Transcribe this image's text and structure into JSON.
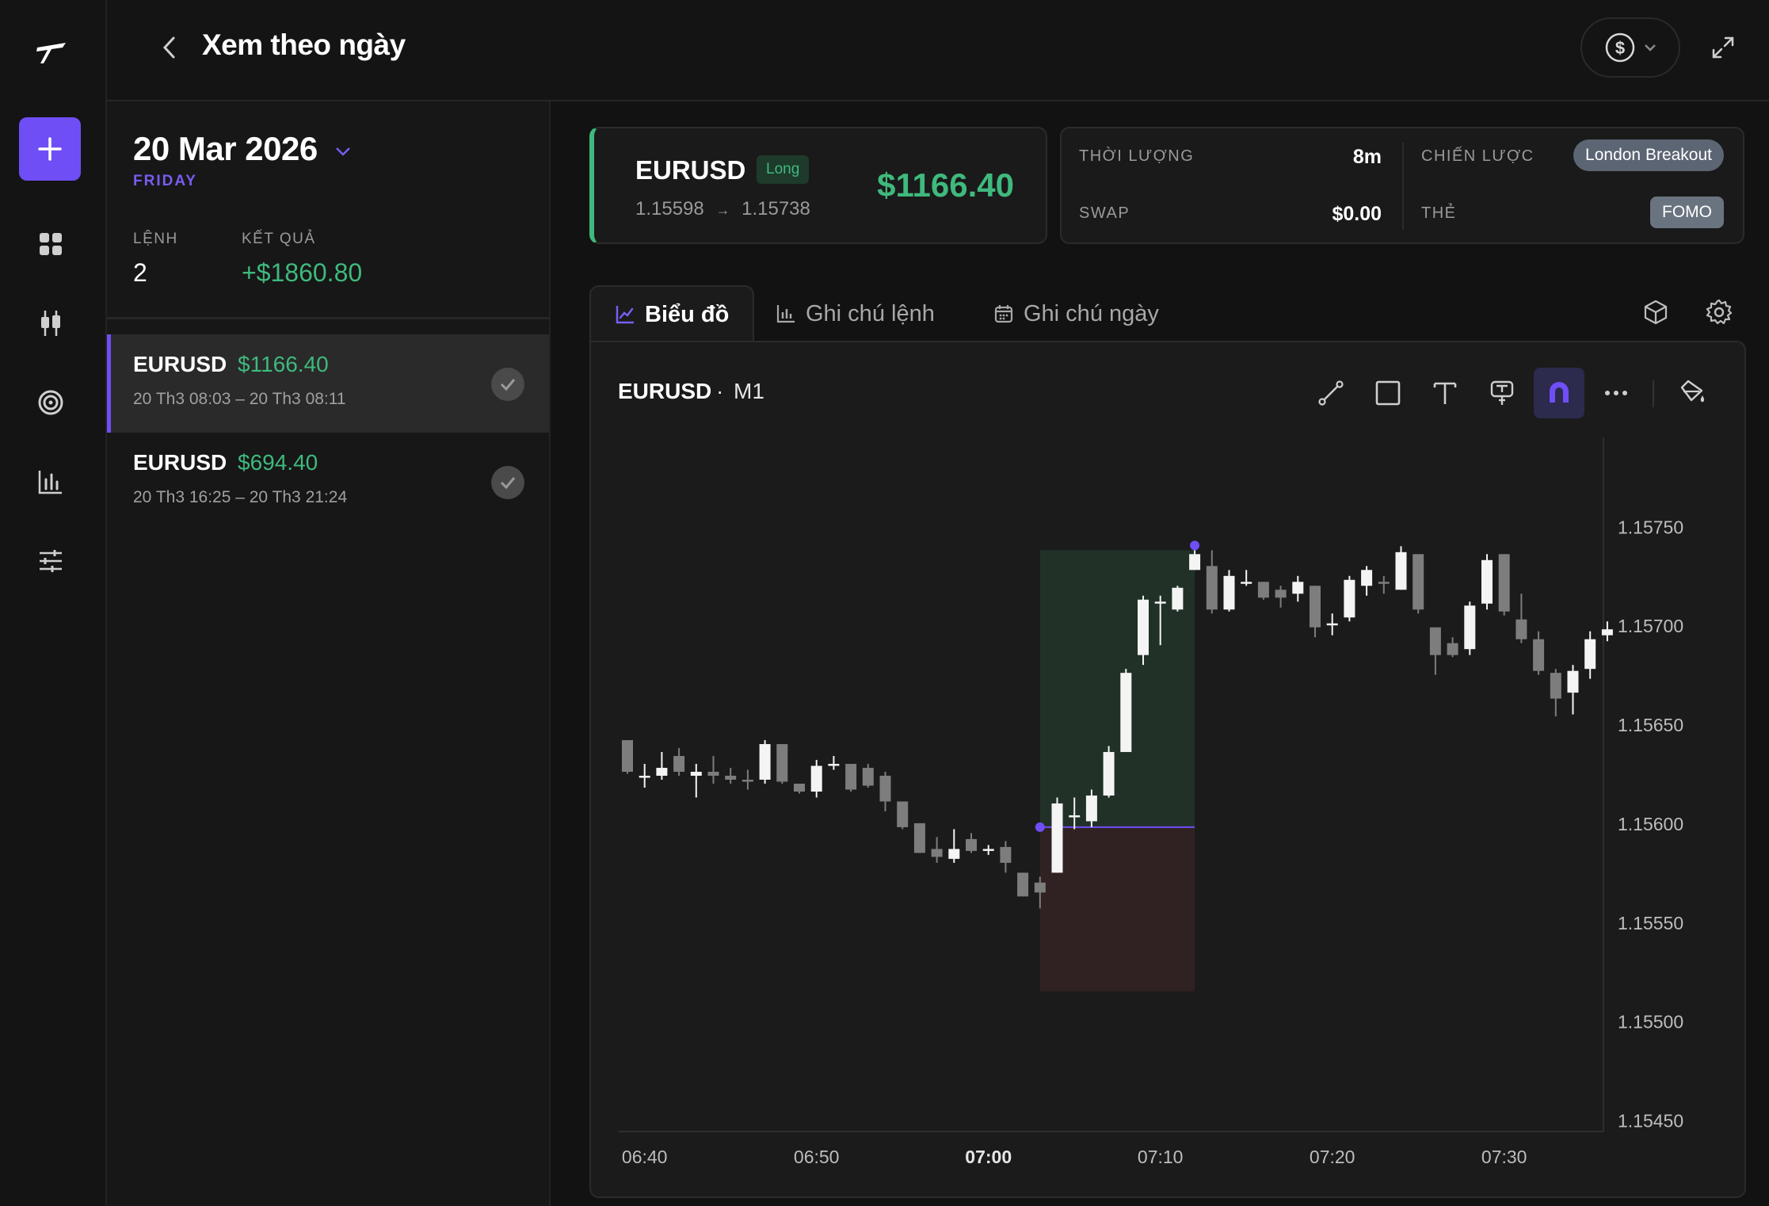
{
  "header": {
    "title": "Xem theo ngày",
    "currency_icon": "dollar-icon"
  },
  "day": {
    "date": "20 Mar 2026",
    "weekday": "FRIDAY",
    "stats": {
      "orders_label": "LỆNH",
      "orders_value": "2",
      "result_label": "KẾT QUẢ",
      "result_value": "+$1860.80"
    }
  },
  "trades": [
    {
      "symbol": "EURUSD",
      "pnl": "$1166.40",
      "time": "20 Th3 08:03 – 20 Th3 08:11",
      "active": true
    },
    {
      "symbol": "EURUSD",
      "pnl": "$694.40",
      "time": "20 Th3 16:25 – 20 Th3 21:24",
      "active": false
    }
  ],
  "trade_card": {
    "symbol": "EURUSD",
    "direction": "Long",
    "entry": "1.15598",
    "arrow": "→",
    "exit": "1.15738",
    "pnl": "$1166.40"
  },
  "info": {
    "duration_label": "THỜI LƯỢNG",
    "duration_value": "8m",
    "swap_label": "SWAP",
    "swap_value": "$0.00",
    "strategy_label": "CHIẾN LƯỢC",
    "strategy_value": "London Breakout",
    "tag_label": "THẺ",
    "tag_value": "FOMO"
  },
  "tabs": [
    {
      "label": "Biểu đồ",
      "icon": "line-chart-icon",
      "active": true
    },
    {
      "label": "Ghi chú lệnh",
      "icon": "bar-chart-icon",
      "active": false
    },
    {
      "label": "Ghi chú ngày",
      "icon": "calendar-icon",
      "active": false
    }
  ],
  "chart_header": {
    "symbol": "EURUSD",
    "separator": "·",
    "timeframe": "M1"
  },
  "colors": {
    "accent": "#6f4ef6",
    "profit": "#3fb97d",
    "candle_up": "#f4f4f4",
    "candle_down": "#7d7d7d",
    "profit_zone": "#213128",
    "loss_zone": "#302222"
  },
  "chart_data": {
    "type": "candlestick",
    "y_ticks": [
      "1.15750",
      "1.15700",
      "1.15650",
      "1.15600",
      "1.15550",
      "1.15500",
      "1.15450"
    ],
    "x_ticks": [
      "06:40",
      "06:50",
      "07:00",
      "07:10",
      "07:20",
      "07:30"
    ],
    "bold_x_tick": "07:00",
    "ylim": [
      1.15445,
      1.15795
    ],
    "x_start": "06:39",
    "interval_minutes": 1,
    "entry_price": 1.15598,
    "exit_price": 1.15738,
    "stop_price": 1.15515,
    "entry_time": "07:03",
    "exit_time": "07:12",
    "candles": [
      [
        1.15642,
        1.15642,
        1.15625,
        1.15626
      ],
      [
        1.15624,
        1.1563,
        1.15618,
        1.15624
      ],
      [
        1.15624,
        1.15636,
        1.15622,
        1.15628
      ],
      [
        1.15634,
        1.15638,
        1.15624,
        1.15626
      ],
      [
        1.15624,
        1.1563,
        1.15613,
        1.15626
      ],
      [
        1.15626,
        1.15634,
        1.1562,
        1.15624
      ],
      [
        1.15624,
        1.15628,
        1.1562,
        1.15622
      ],
      [
        1.15622,
        1.15627,
        1.15617,
        1.15621
      ],
      [
        1.15622,
        1.15642,
        1.1562,
        1.1564
      ],
      [
        1.1564,
        1.1564,
        1.1562,
        1.15621
      ],
      [
        1.1562,
        1.1562,
        1.15615,
        1.15616
      ],
      [
        1.15616,
        1.15632,
        1.15613,
        1.15629
      ],
      [
        1.15629,
        1.15634,
        1.15627,
        1.1563
      ],
      [
        1.1563,
        1.1563,
        1.15616,
        1.15617
      ],
      [
        1.15628,
        1.1563,
        1.15618,
        1.15619
      ],
      [
        1.15624,
        1.15626,
        1.15606,
        1.15611
      ],
      [
        1.15611,
        1.15611,
        1.15597,
        1.15598
      ],
      [
        1.156,
        1.156,
        1.15585,
        1.15585
      ],
      [
        1.15587,
        1.15593,
        1.1558,
        1.15583
      ],
      [
        1.15582,
        1.15597,
        1.1558,
        1.15587
      ],
      [
        1.15592,
        1.15595,
        1.15585,
        1.15586
      ],
      [
        1.15586,
        1.15589,
        1.15584,
        1.15587
      ],
      [
        1.15588,
        1.15591,
        1.15575,
        1.1558
      ],
      [
        1.15575,
        1.15575,
        1.15563,
        1.15563
      ],
      [
        1.1557,
        1.15573,
        1.15557,
        1.15565
      ],
      [
        1.15575,
        1.15613,
        1.15575,
        1.1561
      ],
      [
        1.15603,
        1.15613,
        1.15597,
        1.15604
      ],
      [
        1.15601,
        1.15617,
        1.15598,
        1.15614
      ],
      [
        1.15614,
        1.15639,
        1.15613,
        1.15636
      ],
      [
        1.15636,
        1.15678,
        1.15636,
        1.15676
      ],
      [
        1.15685,
        1.15715,
        1.1568,
        1.15713
      ],
      [
        1.15712,
        1.15715,
        1.1569,
        1.15712
      ],
      [
        1.15708,
        1.1572,
        1.15707,
        1.15719
      ],
      [
        1.15728,
        1.15738,
        1.15728,
        1.15736
      ],
      [
        1.1573,
        1.15738,
        1.15706,
        1.15708
      ],
      [
        1.15708,
        1.15728,
        1.15707,
        1.15725
      ],
      [
        1.15722,
        1.15728,
        1.1572,
        1.15722
      ],
      [
        1.15722,
        1.15722,
        1.15713,
        1.15714
      ],
      [
        1.15718,
        1.1572,
        1.15709,
        1.15714
      ],
      [
        1.15716,
        1.15725,
        1.15712,
        1.15722
      ],
      [
        1.1572,
        1.1572,
        1.15694,
        1.15699
      ],
      [
        1.157,
        1.15706,
        1.15695,
        1.15701
      ],
      [
        1.15704,
        1.15725,
        1.15702,
        1.15723
      ],
      [
        1.1572,
        1.1573,
        1.15715,
        1.15728
      ],
      [
        1.15722,
        1.15725,
        1.15716,
        1.15721
      ],
      [
        1.15718,
        1.1574,
        1.15718,
        1.15737
      ],
      [
        1.15736,
        1.15736,
        1.15706,
        1.15708
      ],
      [
        1.15699,
        1.15699,
        1.15675,
        1.15685
      ],
      [
        1.15691,
        1.15694,
        1.15684,
        1.15685
      ],
      [
        1.15688,
        1.15712,
        1.15685,
        1.1571
      ],
      [
        1.15711,
        1.15736,
        1.15708,
        1.15733
      ],
      [
        1.15736,
        1.15736,
        1.15705,
        1.15707
      ],
      [
        1.15703,
        1.15716,
        1.15691,
        1.15693
      ],
      [
        1.15693,
        1.15697,
        1.15675,
        1.15677
      ],
      [
        1.15676,
        1.15678,
        1.15654,
        1.15663
      ],
      [
        1.15666,
        1.1568,
        1.15655,
        1.15677
      ],
      [
        1.15678,
        1.15697,
        1.15673,
        1.15693
      ],
      [
        1.15695,
        1.15702,
        1.15692,
        1.15698
      ]
    ]
  }
}
